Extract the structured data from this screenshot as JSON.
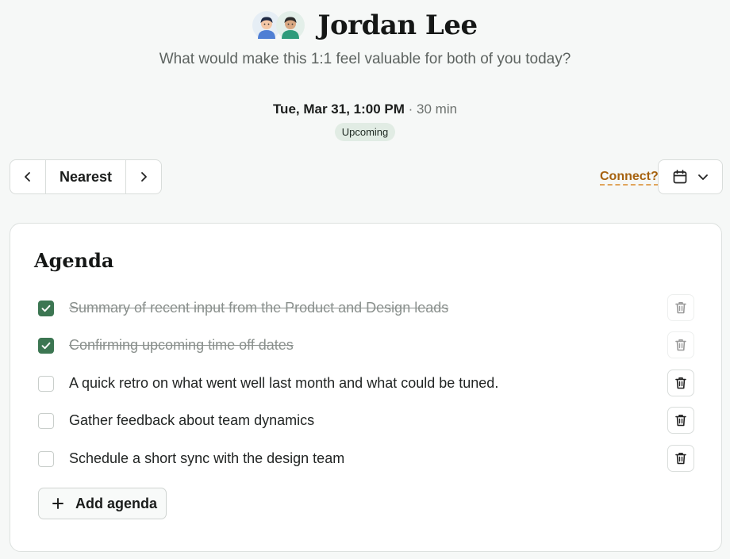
{
  "person": {
    "name": "Jordan Lee"
  },
  "subtitle": "What would make this 1:1 feel valuable for both of you today?",
  "meeting": {
    "date": "Tue, Mar 31, 1:00 PM",
    "duration": "· 30 min",
    "status": "Upcoming"
  },
  "navigation": {
    "current_label": "Nearest",
    "prev_icon": "chevron-left-icon",
    "next_icon": "chevron-right-icon"
  },
  "connect": {
    "label": "Connect?"
  },
  "agenda": {
    "title": "Agenda",
    "items": [
      {
        "text": "Summary of recent input from the Product and Design leads",
        "checked": true
      },
      {
        "text": "Confirming upcoming time off dates",
        "checked": true
      },
      {
        "text": "A quick retro on what went well last month and what could be tuned.",
        "checked": false
      },
      {
        "text": "Gather feedback about team dynamics",
        "checked": false
      },
      {
        "text": "Schedule a short sync with the design team",
        "checked": false
      }
    ],
    "add_label": "Add agenda"
  },
  "colors": {
    "accent_green": "#3c7652",
    "connect_orange": "#a6620f",
    "badge_bg": "#e1ece4"
  }
}
